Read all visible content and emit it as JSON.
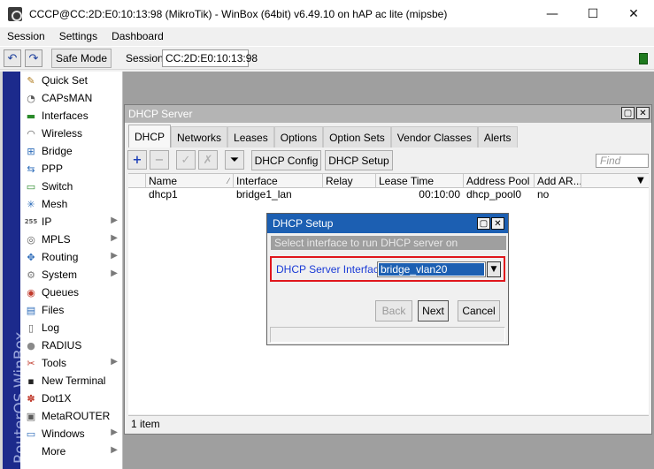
{
  "window": {
    "title": "CCCP@CC:2D:E0:10:13:98 (MikroTik) - WinBox (64bit) v6.49.10 on hAP ac lite (mipsbe)",
    "minimize": "—",
    "maximize": "☐",
    "close": "✕"
  },
  "menu": [
    "Session",
    "Settings",
    "Dashboard"
  ],
  "toolbar": {
    "undo_icon": "↶",
    "redo_icon": "↷",
    "safe_mode": "Safe Mode",
    "session_label": "Session:",
    "session_value": "CC:2D:E0:10:13:98"
  },
  "brand": "RouterOS WinBox",
  "sidebar": [
    {
      "label": "Quick Set",
      "icon": "✎",
      "color": "#b07a1a",
      "arrow": false
    },
    {
      "label": "CAPsMAN",
      "icon": "◔",
      "color": "#5a5a5a",
      "arrow": false
    },
    {
      "label": "Interfaces",
      "icon": "▬",
      "color": "#2a8a2a",
      "arrow": false
    },
    {
      "label": "Wireless",
      "icon": "◠",
      "color": "#5a5a5a",
      "arrow": false
    },
    {
      "label": "Bridge",
      "icon": "⊞",
      "color": "#2a6ab8",
      "arrow": false
    },
    {
      "label": "PPP",
      "icon": "⇆",
      "color": "#2a6ab8",
      "arrow": false
    },
    {
      "label": "Switch",
      "icon": "▭",
      "color": "#2a8a2a",
      "arrow": false
    },
    {
      "label": "Mesh",
      "icon": "✳",
      "color": "#2a6ab8",
      "arrow": false
    },
    {
      "label": "IP",
      "icon": "255",
      "color": "#5a5a5a",
      "arrow": true
    },
    {
      "label": "MPLS",
      "icon": "◎",
      "color": "#5a5a5a",
      "arrow": true
    },
    {
      "label": "Routing",
      "icon": "✥",
      "color": "#2a6ab8",
      "arrow": true
    },
    {
      "label": "System",
      "icon": "⚙",
      "color": "#7a7a7a",
      "arrow": true
    },
    {
      "label": "Queues",
      "icon": "◉",
      "color": "#c0392b",
      "arrow": false
    },
    {
      "label": "Files",
      "icon": "▤",
      "color": "#2a6ab8",
      "arrow": false
    },
    {
      "label": "Log",
      "icon": "▯",
      "color": "#5a5a5a",
      "arrow": false
    },
    {
      "label": "RADIUS",
      "icon": "●",
      "color": "#8a8a8a",
      "arrow": false
    },
    {
      "label": "Tools",
      "icon": "✂",
      "color": "#c0392b",
      "arrow": true
    },
    {
      "label": "New Terminal",
      "icon": "▪",
      "color": "#222222",
      "arrow": false
    },
    {
      "label": "Dot1X",
      "icon": "✽",
      "color": "#c0392b",
      "arrow": false
    },
    {
      "label": "MetaROUTER",
      "icon": "▣",
      "color": "#5a5a5a",
      "arrow": false
    },
    {
      "label": "Windows",
      "icon": "▭",
      "color": "#2a6ab8",
      "arrow": true
    },
    {
      "label": "More",
      "icon": "",
      "color": "#5a5a5a",
      "arrow": true
    }
  ],
  "dhcp_server": {
    "title": "DHCP Server",
    "tabs": [
      "DHCP",
      "Networks",
      "Leases",
      "Options",
      "Option Sets",
      "Vendor Classes",
      "Alerts"
    ],
    "buttons": {
      "add": "+",
      "remove": "−",
      "enable": "✓",
      "disable": "✗",
      "filter": "⏷",
      "dhcp_config": "DHCP Config",
      "dhcp_setup": "DHCP Setup"
    },
    "find_placeholder": "Find",
    "columns": [
      "Name",
      "Interface",
      "Relay",
      "Lease Time",
      "Address Pool",
      "Add AR..."
    ],
    "rows": [
      {
        "name": "dhcp1",
        "interface": "bridge1_lan",
        "relay": "",
        "lease_time": "00:10:00",
        "address_pool": "dhcp_pool0",
        "add_arp": "no"
      }
    ],
    "status": "1 item"
  },
  "dhcp_setup": {
    "title": "DHCP Setup",
    "instruction": "Select interface to run DHCP server on",
    "field_label": "DHCP Server Interface:",
    "field_value": "bridge_vlan20",
    "back": "Back",
    "next": "Next",
    "cancel": "Cancel"
  }
}
